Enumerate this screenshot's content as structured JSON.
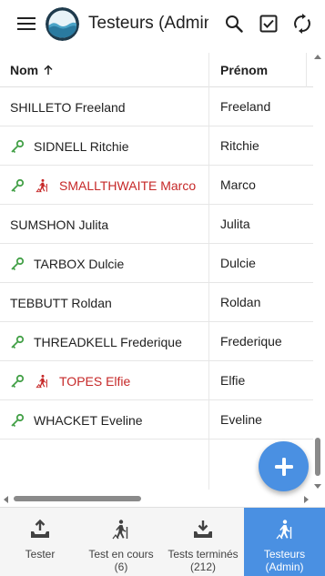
{
  "appbar": {
    "title": "Testeurs (Admin)",
    "menu_icon": "hamburger-menu-icon",
    "logo": "water-logo",
    "actions": [
      "search-icon",
      "checkbox-icon",
      "sync-icon"
    ]
  },
  "table": {
    "headers": {
      "name": "Nom",
      "first": "Prénom"
    },
    "sort_icon": "arrow-up-icon",
    "rows": [
      {
        "name": "SHILLETO Freeland",
        "first": "Freeland",
        "key": false,
        "hiker": false,
        "highlight": false
      },
      {
        "name": "SIDNELL Ritchie",
        "first": "Ritchie",
        "key": true,
        "hiker": false,
        "highlight": false
      },
      {
        "name": "SMALLTHWAITE Marco",
        "first": "Marco",
        "key": true,
        "hiker": true,
        "highlight": true
      },
      {
        "name": "SUMSHON Julita",
        "first": "Julita",
        "key": false,
        "hiker": false,
        "highlight": false
      },
      {
        "name": "TARBOX Dulcie",
        "first": "Dulcie",
        "key": true,
        "hiker": false,
        "highlight": false
      },
      {
        "name": "TEBBUTT Roldan",
        "first": "Roldan",
        "key": false,
        "hiker": false,
        "highlight": false
      },
      {
        "name": "THREADKELL Frederique",
        "first": "Frederique",
        "key": true,
        "hiker": false,
        "highlight": false
      },
      {
        "name": "TOPES Elfie",
        "first": "Elfie",
        "key": true,
        "hiker": true,
        "highlight": true
      },
      {
        "name": "WHACKET Eveline",
        "first": "Eveline",
        "key": true,
        "hiker": false,
        "highlight": false
      }
    ]
  },
  "fab": {
    "icon": "plus-icon"
  },
  "bottomnav": {
    "items": [
      {
        "label": "Tester",
        "sub": "",
        "icon": "tray-upload-icon",
        "active": false
      },
      {
        "label": "Test en cours",
        "sub": "(6)",
        "icon": "hiker-icon",
        "active": false
      },
      {
        "label": "Tests terminés",
        "sub": "(212)",
        "icon": "tray-download-icon",
        "active": false
      },
      {
        "label": "Testeurs",
        "sub": "(Admin)",
        "icon": "hiker-icon",
        "active": true
      }
    ]
  },
  "colors": {
    "accent": "#4a90e2",
    "key": "#43a047",
    "highlight_text": "#c62828"
  }
}
